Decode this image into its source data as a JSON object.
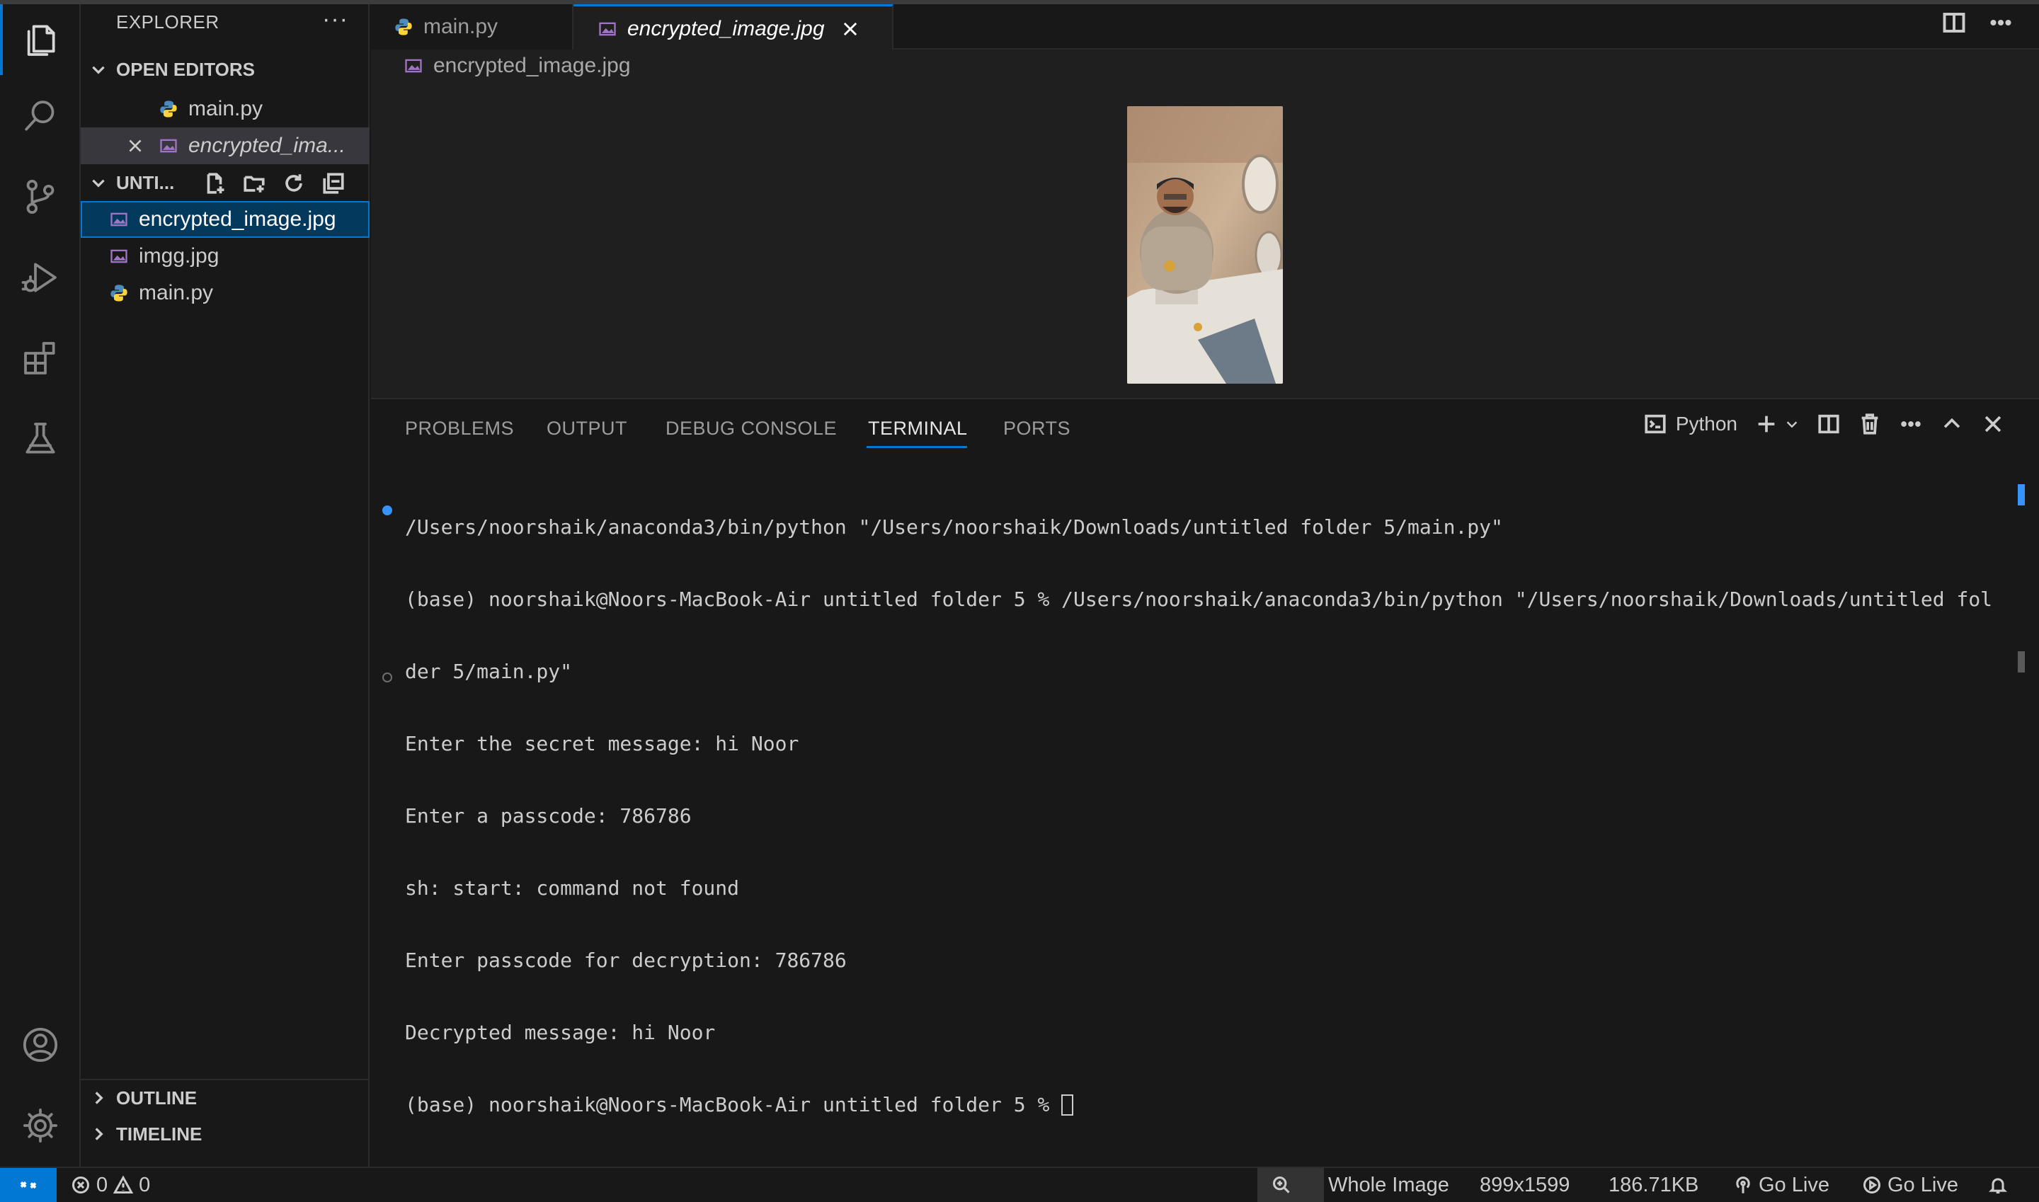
{
  "explorer": {
    "title": "EXPLORER",
    "more": "···",
    "open_editors_label": "OPEN EDITORS",
    "open_editors": [
      {
        "name": "main.py",
        "type": "python"
      },
      {
        "name": "encrypted_ima...",
        "type": "image"
      }
    ],
    "folder_label": "UNTI...",
    "files": [
      {
        "name": "encrypted_image.jpg",
        "type": "image"
      },
      {
        "name": "imgg.jpg",
        "type": "image"
      },
      {
        "name": "main.py",
        "type": "python"
      }
    ],
    "outline_label": "OUTLINE",
    "timeline_label": "TIMELINE"
  },
  "tabs": [
    {
      "label": "main.py",
      "type": "python",
      "active": false
    },
    {
      "label": "encrypted_image.jpg",
      "type": "image",
      "active": true
    }
  ],
  "breadcrumb": "encrypted_image.jpg",
  "panel": {
    "tabs": [
      "PROBLEMS",
      "OUTPUT",
      "DEBUG CONSOLE",
      "TERMINAL",
      "PORTS"
    ],
    "active_tab": "TERMINAL",
    "terminal_profile": "Python"
  },
  "terminal_lines": [
    "/Users/noorshaik/anaconda3/bin/python \"/Users/noorshaik/Downloads/untitled folder 5/main.py\"",
    "(base) noorshaik@Noors-MacBook-Air untitled folder 5 % /Users/noorshaik/anaconda3/bin/python \"/Users/noorshaik/Downloads/untitled fol",
    "der 5/main.py\"",
    "Enter the secret message: hi Noor",
    "Enter a passcode: 786786",
    "sh: start: command not found",
    "Enter passcode for decryption: 786786",
    "Decrypted message: hi Noor",
    "(base) noorshaik@Noors-MacBook-Air untitled folder 5 % "
  ],
  "status": {
    "errors": "0",
    "warnings": "0",
    "zoom_mode": "Whole Image",
    "dimensions": "899x1599",
    "file_size": "186.71KB",
    "go_live_1": "Go Live",
    "go_live_2": "Go Live"
  },
  "colors": {
    "accent": "#0078d4",
    "selection": "#04395e",
    "background": "#181818",
    "editor_bg": "#1f1f1f"
  },
  "icons": [
    "files-icon",
    "search-icon",
    "source-control-icon",
    "run-debug-icon",
    "extensions-icon",
    "testing-icon",
    "account-icon",
    "settings-gear-icon"
  ]
}
